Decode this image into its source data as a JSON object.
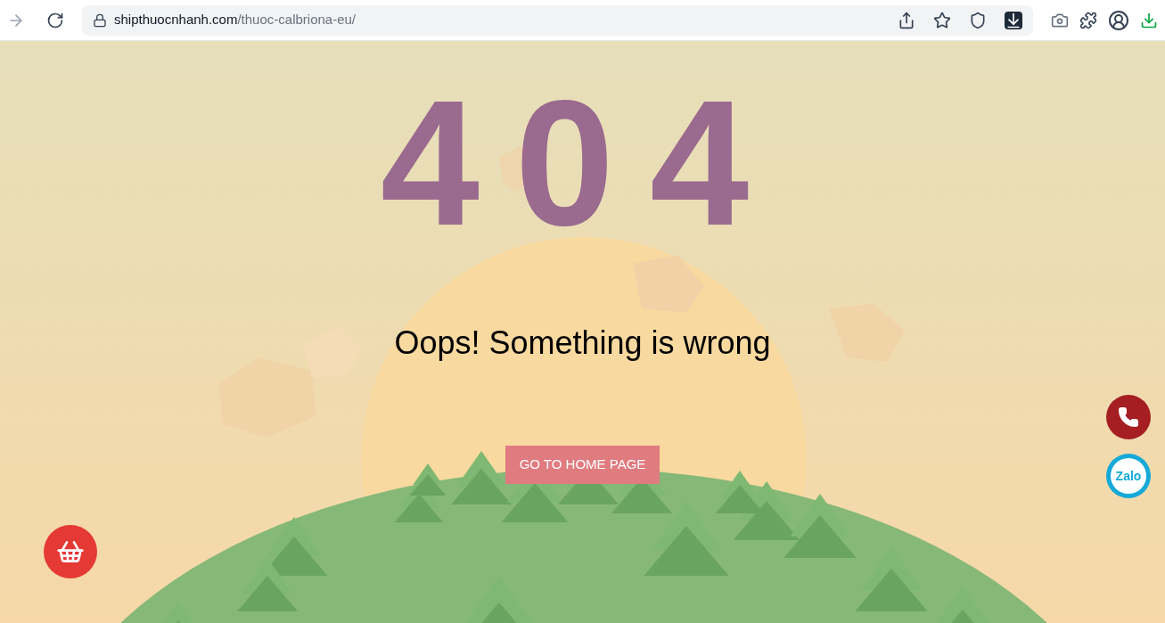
{
  "browser": {
    "url_host": "shipthuocnhanh.com",
    "url_path": "/thuoc-calbriona-eu/"
  },
  "page": {
    "code": "404",
    "message": "Oops! Something is wrong",
    "home_button": "GO TO HOME PAGE",
    "zalo_label": "Zalo"
  }
}
